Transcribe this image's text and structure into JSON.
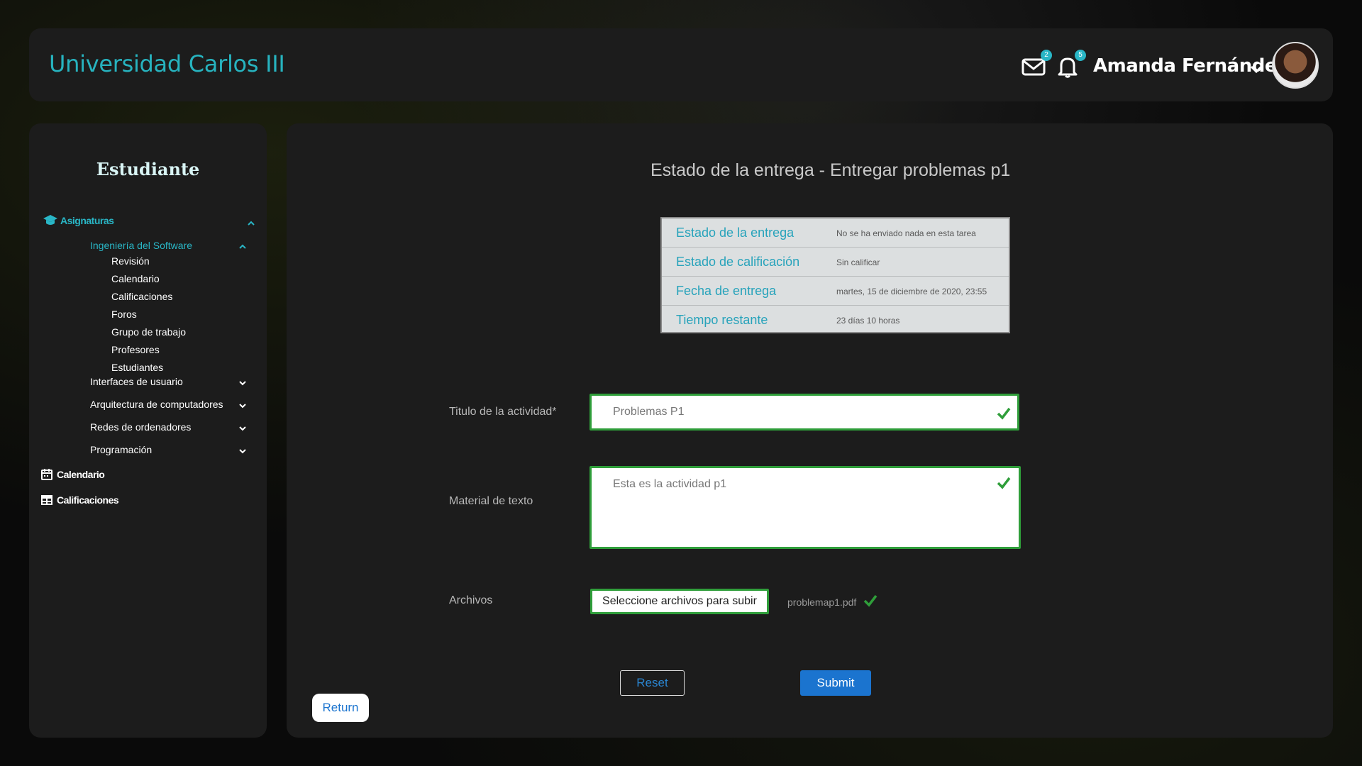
{
  "header": {
    "brand": "Universidad Carlos III",
    "mail_badge": "2",
    "bell_badge": "5",
    "user_name": "Amanda Fernández"
  },
  "sidebar": {
    "title": "Estudiante",
    "asignaturas_label": "Asignaturas",
    "active_course": "Ingeniería del Software",
    "course_items": [
      "Revisión",
      "Calendario",
      "Calificaciones",
      "Foros",
      "Grupo de trabajo",
      "Profesores",
      "Estudiantes"
    ],
    "other_courses": [
      "Interfaces de usuario",
      "Arquitectura de computadores",
      "Redes de ordenadores",
      "Programación"
    ],
    "calendario_label": "Calendario",
    "calificaciones_label": "Calificaciones"
  },
  "main": {
    "title": "Estado de la entrega - Entregar problemas p1",
    "status": [
      {
        "label": "Estado de la entrega",
        "value": "No se ha enviado nada en esta tarea"
      },
      {
        "label": "Estado de calificación",
        "value": "Sin calificar"
      },
      {
        "label": "Fecha de entrega",
        "value": "martes, 15 de diciembre de 2020, 23:55"
      },
      {
        "label": "Tiempo restante",
        "value": "23 días 10 horas"
      }
    ],
    "form": {
      "title_label": "Titulo de la actividad*",
      "title_value": "Problemas P1",
      "text_label": "Material de texto",
      "text_value": "Esta es la actividad p1",
      "files_label": "Archivos",
      "file_button": "Seleccione archivos para subir",
      "file_name": "problemap1.pdf"
    },
    "buttons": {
      "reset": "Reset",
      "submit": "Submit",
      "return": "Return"
    }
  },
  "colors": {
    "accent": "#27b3bf",
    "valid": "#2f9e3a",
    "primary": "#1b74cf"
  }
}
